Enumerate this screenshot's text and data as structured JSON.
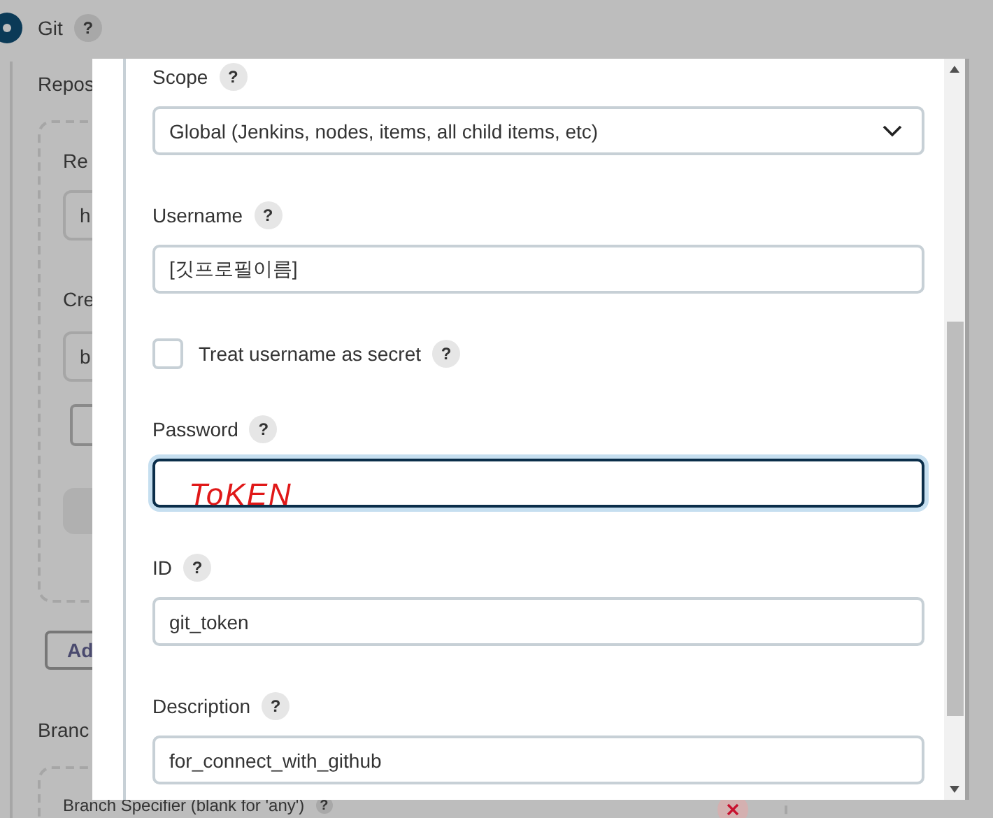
{
  "background": {
    "git_option": {
      "label": "Git",
      "help": "?",
      "selected": true
    },
    "repositories_label": "Repos",
    "repo_url_label": "Re",
    "repo_url_value": "h",
    "credentials_label": "Cre",
    "credentials_value": "b",
    "add_button": "Ad",
    "branches_label": "Branc",
    "branch_specifier_label": "Branch Specifier (blank for 'any')",
    "branch_specifier_help": "?"
  },
  "dialog": {
    "annotation": "ToKEN",
    "fields": [
      {
        "kind": "select",
        "label": "Scope",
        "help": "?",
        "value": "Global (Jenkins, nodes, items, all child items, etc)"
      },
      {
        "kind": "text",
        "label": "Username",
        "help": "?",
        "value": "[깃프로필이름]"
      },
      {
        "kind": "checkbox",
        "label": "Treat username as secret",
        "help": "?",
        "checked": false
      },
      {
        "kind": "password",
        "label": "Password",
        "help": "?",
        "focused": true
      },
      {
        "kind": "text",
        "label": "ID",
        "help": "?",
        "value": "git_token"
      },
      {
        "kind": "text",
        "label": "Description",
        "help": "?",
        "value": "for_connect_with_github"
      }
    ]
  }
}
